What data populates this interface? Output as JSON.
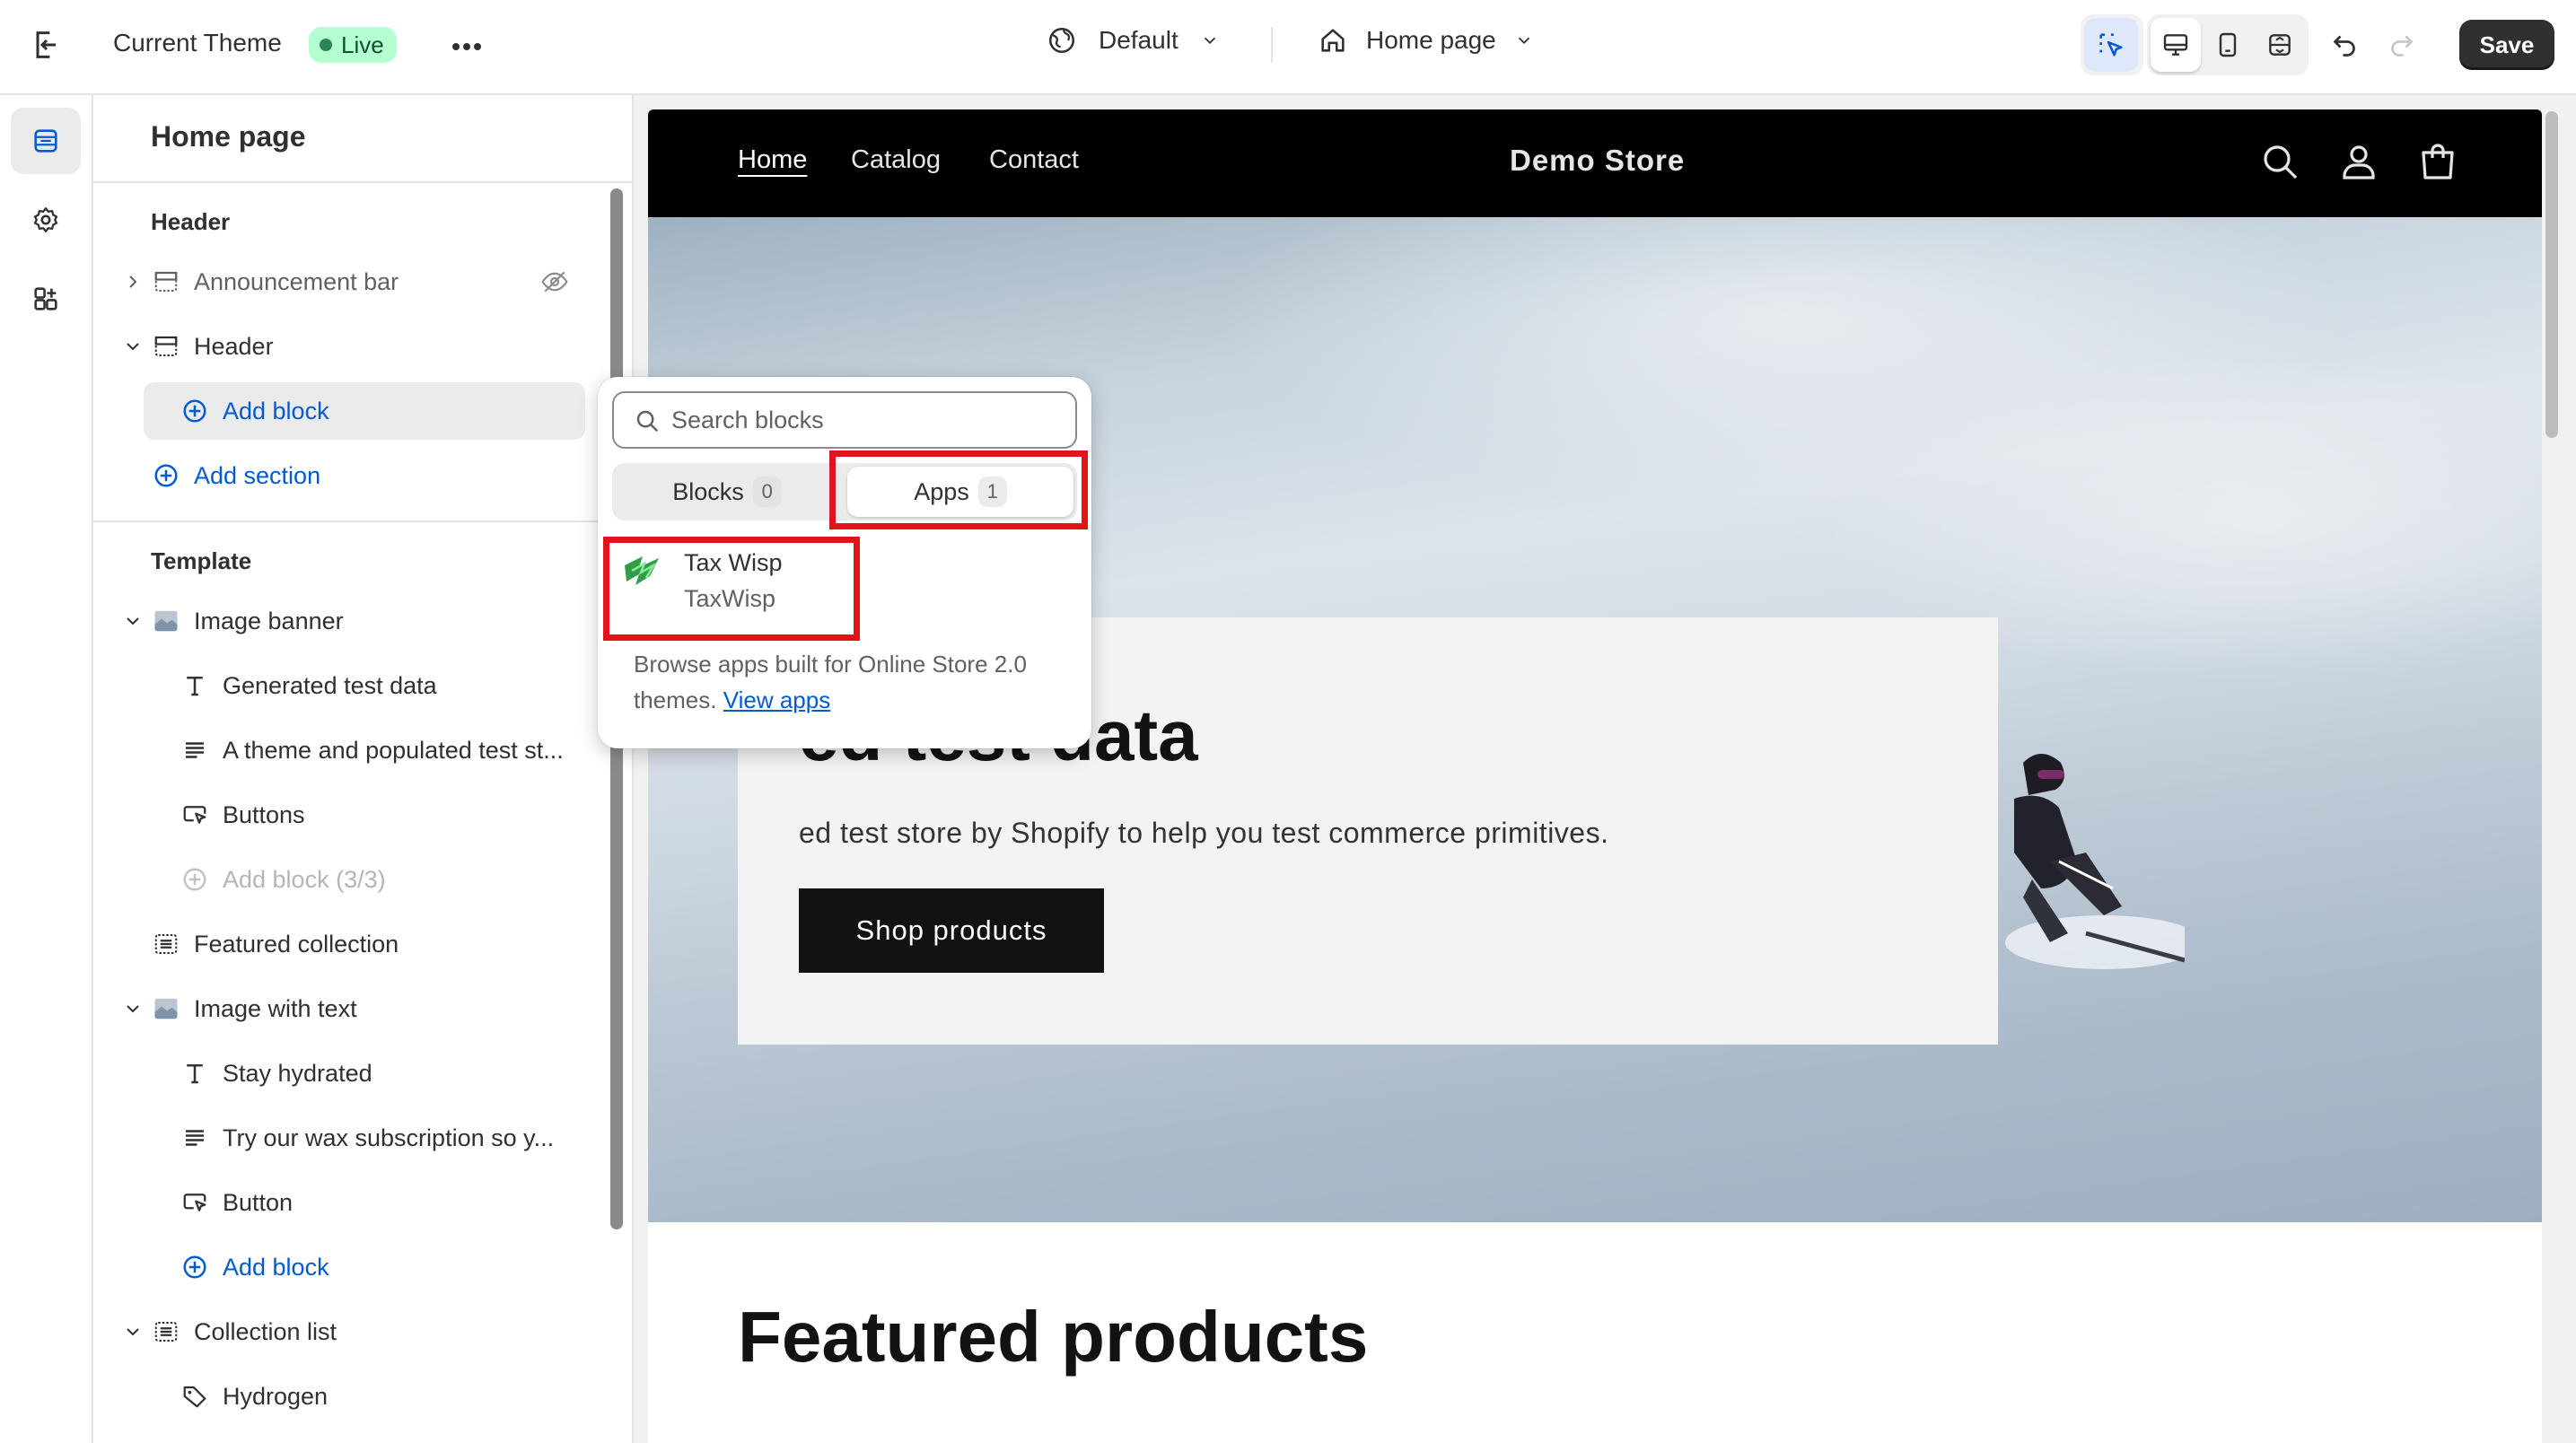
{
  "topbar": {
    "theme_name": "Current Theme",
    "live_badge": "Live",
    "theme_selector": "Default",
    "page_selector": "Home page",
    "save_label": "Save"
  },
  "sidebar": {
    "title": "Home page",
    "header_group": "Header",
    "header_items": [
      {
        "label": "Announcement bar"
      },
      {
        "label": "Header"
      },
      {
        "label": "Add block"
      },
      {
        "label": "Add section"
      }
    ],
    "template_group": "Template",
    "template_items": [
      {
        "label": "Image banner"
      },
      {
        "label": "Generated test data"
      },
      {
        "label": "A theme and populated test st..."
      },
      {
        "label": "Buttons"
      },
      {
        "label": "Add block (3/3)"
      },
      {
        "label": "Featured collection"
      },
      {
        "label": "Image with text"
      },
      {
        "label": "Stay hydrated"
      },
      {
        "label": "Try our wax subscription so y..."
      },
      {
        "label": "Button"
      },
      {
        "label": "Add block"
      },
      {
        "label": "Collection list"
      },
      {
        "label": "Hydrogen"
      }
    ]
  },
  "preview": {
    "nav": [
      "Home",
      "Catalog",
      "Contact"
    ],
    "store_name": "Demo Store",
    "hero_title": "ed test data",
    "hero_subtitle": "ed test store by Shopify to help you test commerce primitives.",
    "hero_button": "Shop products",
    "featured_title": "Featured products"
  },
  "popover": {
    "search_placeholder": "Search blocks",
    "tabs": [
      {
        "label": "Blocks",
        "count": "0"
      },
      {
        "label": "Apps",
        "count": "1"
      }
    ],
    "app": {
      "name": "Tax Wisp",
      "developer": "TaxWisp"
    },
    "footer_text": "Browse apps built for Online Store 2.0 themes.",
    "footer_link": "View apps"
  },
  "colors": {
    "highlight": "#e3131b",
    "accent_blue": "#005bd3",
    "live_green": "#b4fed2"
  }
}
